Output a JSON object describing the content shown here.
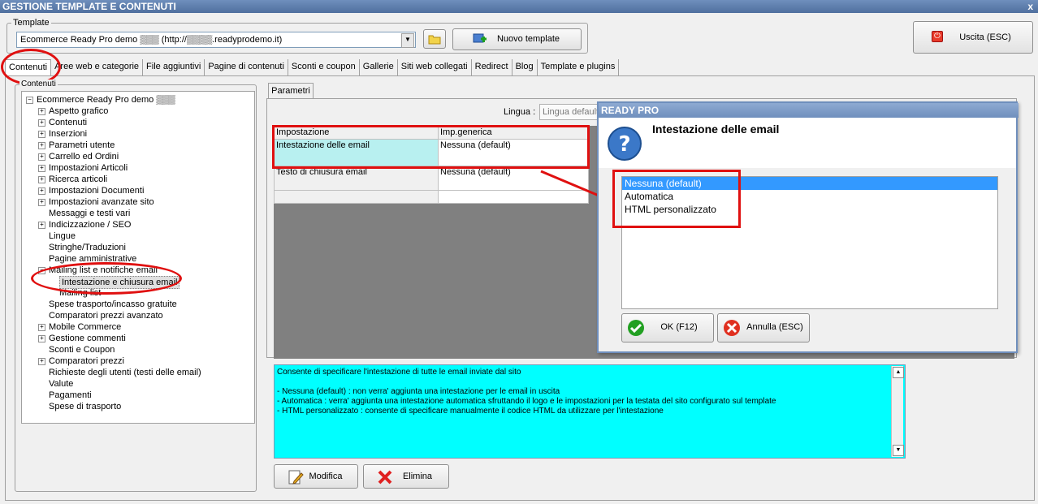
{
  "window": {
    "title": "GESTIONE TEMPLATE E CONTENUTI",
    "close": "x"
  },
  "template": {
    "group_label": "Template",
    "select_value": "Ecommerce Ready Pro demo ▒▒▒ (http://▒▒▒▒.readyprodemo.it)",
    "new_button": "Nuovo template"
  },
  "exit_button": "Uscita (ESC)",
  "tabs": [
    "Contenuti",
    "Aree web e categorie",
    "File aggiuntivi",
    "Pagine di contenuti",
    "Sconti e coupon",
    "Gallerie",
    "Siti web collegati",
    "Redirect",
    "Blog",
    "Template e plugins"
  ],
  "tree": {
    "group_label": "Contenuti",
    "root": "Ecommerce Ready Pro demo ▒▒▒",
    "items": [
      {
        "label": "Aspetto grafico",
        "plus": true
      },
      {
        "label": "Contenuti",
        "plus": true
      },
      {
        "label": "Inserzioni",
        "plus": true
      },
      {
        "label": "Parametri utente",
        "plus": true
      },
      {
        "label": "Carrello ed Ordini",
        "plus": true
      },
      {
        "label": "Impostazioni Articoli",
        "plus": true
      },
      {
        "label": "Ricerca articoli",
        "plus": true
      },
      {
        "label": "Impostazioni Documenti",
        "plus": true
      },
      {
        "label": "Impostazioni avanzate sito",
        "plus": true
      },
      {
        "label": "Messaggi e testi vari",
        "plus": false
      },
      {
        "label": "Indicizzazione / SEO",
        "plus": true
      },
      {
        "label": "Lingue",
        "plus": false
      },
      {
        "label": "Stringhe/Traduzioni",
        "plus": false
      },
      {
        "label": "Pagine amministrative",
        "plus": false
      },
      {
        "label": "Mailing list e notifiche email",
        "plus": true,
        "expanded": true
      },
      {
        "label": "Intestazione e chiusura email",
        "plus": false,
        "child": true,
        "selected": true
      },
      {
        "label": "Mailing list",
        "plus": false,
        "child": true
      },
      {
        "label": "Spese trasporto/incasso gratuite",
        "plus": false
      },
      {
        "label": "Comparatori prezzi avanzato",
        "plus": false
      },
      {
        "label": "Mobile Commerce",
        "plus": true
      },
      {
        "label": "Gestione commenti",
        "plus": true
      },
      {
        "label": "Sconti e Coupon",
        "plus": false
      },
      {
        "label": "Comparatori prezzi",
        "plus": true
      },
      {
        "label": "Richieste degli utenti (testi delle email)",
        "plus": false
      },
      {
        "label": "Valute",
        "plus": false
      },
      {
        "label": "Pagamenti",
        "plus": false
      },
      {
        "label": "Spese di trasporto",
        "plus": false
      }
    ]
  },
  "params": {
    "tab": "Parametri",
    "lingua_label": "Lingua :",
    "lingua_value": "Lingua default",
    "columns": [
      "Impostazione",
      "Imp.generica"
    ],
    "rows": [
      [
        "Intestazione delle email",
        "Nessuna (default)"
      ],
      [
        "Testo di chiusura email",
        "Nessuna (default)"
      ]
    ]
  },
  "description": {
    "title": "Consente di specificare l'intestazione di tutte le email inviate dal sito",
    "lines": [
      "- Nessuna (default) : non verra' aggiunta una intestazione per le email in uscita",
      "- Automatica : verra' aggiunta una intestazione automatica sfruttando il logo e le impostazioni per la testata del sito configurato sul template",
      "- HTML personalizzato : consente di specificare manualmente il codice HTML da utilizzare per l'intestazione"
    ]
  },
  "buttons": {
    "modifica": "Modifica",
    "elimina": "Elimina"
  },
  "dialog": {
    "title": "READY PRO",
    "heading": "Intestazione delle email",
    "options": [
      "Nessuna (default)",
      "Automatica",
      "HTML personalizzato"
    ],
    "ok": "OK (F12)",
    "cancel": "Annulla (ESC)"
  },
  "colors": {
    "accent_red": "#e01010",
    "cyan": "#00ffff",
    "selection": "#3399ff"
  }
}
